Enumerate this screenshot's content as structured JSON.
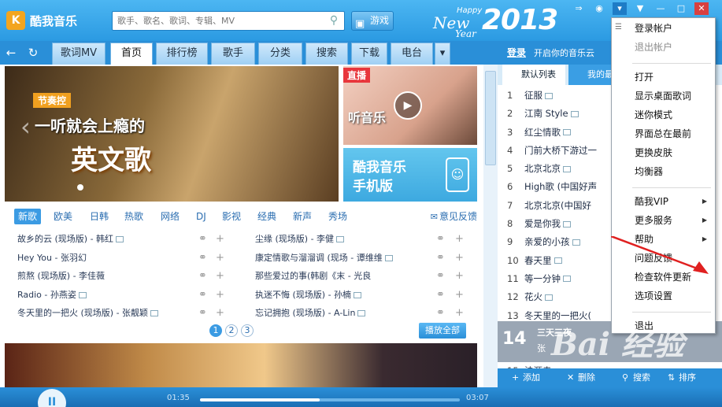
{
  "app": {
    "logo_text": "K",
    "name": "酷我音乐"
  },
  "search": {
    "placeholder": "歌手、歌名、歌词、专辑、MV",
    "icon": "search-icon"
  },
  "game_button": {
    "label": "游戏"
  },
  "new_year": {
    "happy": "Happy",
    "new": "New",
    "year": "Year",
    "number": "2013"
  },
  "nav": {
    "back": "←",
    "refresh": "↻",
    "tabs": [
      "歌词MV",
      "首页",
      "排行榜",
      "歌手",
      "分类",
      "搜索",
      "下载",
      "电台"
    ],
    "active": "首页",
    "more": "▾"
  },
  "banner": {
    "tag": "节奏控",
    "line1": "一听就会上瘾的",
    "line2": "英文歌"
  },
  "live": {
    "badge": "直播",
    "text": "听音乐"
  },
  "mobile": {
    "line1": "酷我音乐",
    "line2": "手机版"
  },
  "categories": {
    "items": [
      "新歌",
      "欧美",
      "日韩",
      "热歌",
      "网络",
      "DJ",
      "影视",
      "经典",
      "新声",
      "秀场"
    ],
    "active": "新歌",
    "feedback": "意见反馈"
  },
  "songs": [
    {
      "left": "故乡的云 (现场版) - 韩红",
      "right": "尘缘 (现场版) - 李健"
    },
    {
      "left": "Hey You - 张羽幻",
      "right": "康定情歌与溜溜调 (现场 - 谭维维"
    },
    {
      "left": "煎熬 (现场版) - 李佳薇",
      "right": "那些爱过的事(韩剧《末 - 光良"
    },
    {
      "left": "Radio - 孙燕姿",
      "right": "执迷不悔 (现场版) - 孙楠"
    },
    {
      "left": "冬天里的一把火 (现场版) - 张靓颖",
      "right": "忘记拥抱 (现场版) - A-Lin"
    }
  ],
  "pager": {
    "pages": [
      "1",
      "2",
      "3"
    ],
    "active": "1"
  },
  "play_all": "播放全部",
  "login": {
    "link": "登录",
    "message": "开启你的音乐云"
  },
  "playlist_tabs": {
    "tab1": "默认列表",
    "tab2": "我的最"
  },
  "playlist": [
    "征服",
    "江南 Style",
    "红尘情歌",
    "门前大桥下游过一",
    "北京北京",
    "High歌 (中国好声",
    "北京北京(中国好",
    "爱是你我",
    "亲爱的小孩",
    "春天里",
    "等一分钟",
    "花火",
    "冬天里的一把火(",
    "法源寺"
  ],
  "now_playing": {
    "number": "14",
    "title": "三天三夜",
    "artist": "张"
  },
  "right_bottom": {
    "add": "添加",
    "delete": "删除",
    "search": "搜索",
    "sort": "排序"
  },
  "player": {
    "play": "II",
    "current_time": "01:35",
    "end_time": "03:07",
    "progress": 0.46
  },
  "menu": [
    {
      "label": "登录帐户",
      "disabled": false
    },
    {
      "label": "退出帐户",
      "disabled": true
    },
    {
      "sep": true
    },
    {
      "label": "打开",
      "disabled": false
    },
    {
      "label": "显示桌面歌词",
      "disabled": false
    },
    {
      "label": "迷你模式",
      "disabled": false
    },
    {
      "label": "界面总在最前",
      "disabled": false
    },
    {
      "label": "更换皮肤",
      "disabled": false
    },
    {
      "label": "均衡器",
      "disabled": false
    },
    {
      "sep": true
    },
    {
      "label": "酷我VIP",
      "disabled": false,
      "submenu": true
    },
    {
      "label": "更多服务",
      "disabled": false,
      "submenu": true
    },
    {
      "label": "帮助",
      "disabled": false,
      "submenu": true
    },
    {
      "label": "问题反馈",
      "disabled": false
    },
    {
      "label": "检查软件更新",
      "disabled": false
    },
    {
      "label": "选项设置",
      "disabled": false
    },
    {
      "sep": true
    },
    {
      "label": "退出",
      "disabled": false
    }
  ],
  "watermark": "Bai 经验",
  "colors": {
    "brand_blue": "#2a9ee6",
    "accent_orange": "#f3a51e",
    "live_red": "#e8363c",
    "arrow_red": "#e02020"
  }
}
